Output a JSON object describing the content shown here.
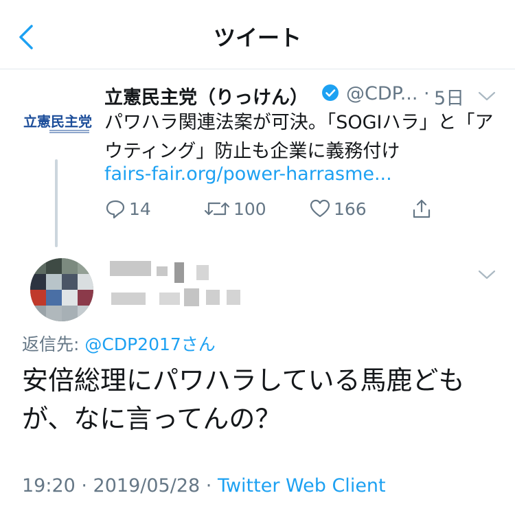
{
  "header": {
    "title": "ツイート",
    "back_icon": "chevron-left-icon"
  },
  "colors": {
    "accent": "#1da1f2",
    "muted": "#657786",
    "text": "#14171a",
    "divider": "#e1e8ed"
  },
  "parent_tweet": {
    "avatar_text": "立憲民主党",
    "author_name": "立憲民主党（りっけん）",
    "handle": "@CDP...",
    "separator": "·",
    "time": "5日",
    "text": "パワハラ関連法案が可決。「SOGIハラ」と「アウティング」防止も企業に義務付け",
    "link": "fairs-fair.org/power-harrasme...",
    "actions": {
      "reply_count": "14",
      "retweet_count": "100",
      "like_count": "166"
    }
  },
  "reply_tweet": {
    "reply_to_label": "返信先: ",
    "reply_to_handle": "@CDP2017",
    "reply_to_suffix": "さん",
    "text": "安倍総理にパワハラしている馬鹿どもが、なに言ってんの？",
    "timestamp": "19:20 · 2019/05/28 · ",
    "client": "Twitter Web Client"
  }
}
